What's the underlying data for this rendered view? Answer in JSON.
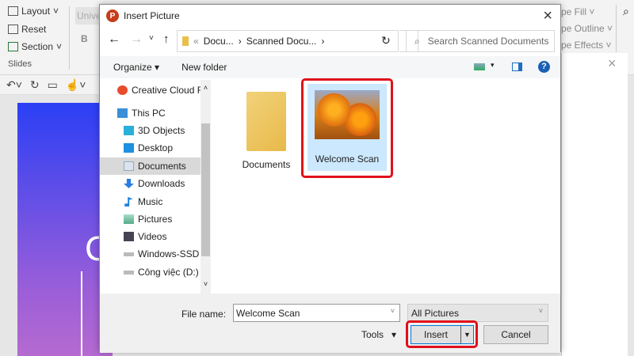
{
  "ribbon": {
    "layout": "Layout",
    "reset": "Reset",
    "section": "Section",
    "group": "Slides",
    "font_box": "Unive",
    "bold": "B",
    "shape_fill": "pe Fill",
    "shape_outline": "pe Outline",
    "shape_effects": "pe Effects"
  },
  "slide": {
    "text": "C"
  },
  "dialog": {
    "title": "Insert Picture",
    "breadcrumb": [
      "Docu...",
      "Scanned Docu..."
    ],
    "search_placeholder": "Search Scanned Documents",
    "organize": "Organize",
    "new_folder": "New folder",
    "nav": [
      {
        "label": "Creative Cloud Files",
        "icon": "creative-cloud-icon"
      },
      {
        "label": "This PC",
        "icon": "pc-icon"
      },
      {
        "label": "3D Objects",
        "icon": "cube-icon"
      },
      {
        "label": "Desktop",
        "icon": "desktop-icon"
      },
      {
        "label": "Documents",
        "icon": "documents-icon",
        "selected": true
      },
      {
        "label": "Downloads",
        "icon": "download-icon"
      },
      {
        "label": "Music",
        "icon": "music-icon"
      },
      {
        "label": "Pictures",
        "icon": "pictures-icon"
      },
      {
        "label": "Videos",
        "icon": "videos-icon"
      },
      {
        "label": "Windows-SSD (C:)",
        "icon": "drive-icon"
      },
      {
        "label": "Công việc (D:)",
        "icon": "drive-icon"
      }
    ],
    "files": [
      {
        "name": "Documents",
        "type": "folder"
      },
      {
        "name": "Welcome Scan",
        "type": "image",
        "selected": true
      }
    ],
    "file_name_label": "File name:",
    "file_name_value": "Welcome Scan",
    "file_type": "All Pictures",
    "tools": "Tools",
    "insert": "Insert",
    "cancel": "Cancel"
  },
  "colors": {
    "highlight": "#e0101b",
    "selection": "#cce8ff",
    "accent": "#0067c0"
  }
}
